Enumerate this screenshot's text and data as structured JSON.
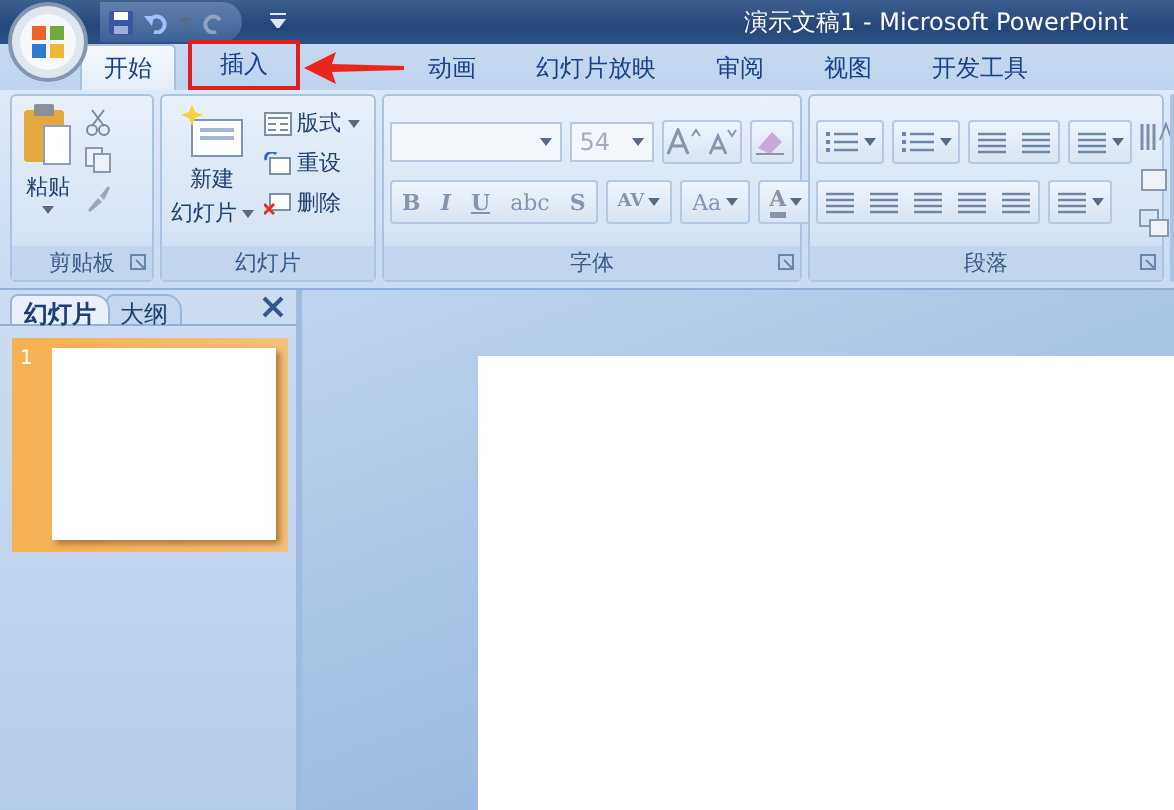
{
  "window": {
    "title": "演示文稿1 - Microsoft PowerPoint"
  },
  "tabs": [
    {
      "label": "开始",
      "selected": true,
      "highlighted": false
    },
    {
      "label": "插入",
      "selected": false,
      "highlighted": true
    },
    {
      "label": "动画",
      "selected": false,
      "highlighted": false
    },
    {
      "label": "幻灯片放映",
      "selected": false,
      "highlighted": false
    },
    {
      "label": "审阅",
      "selected": false,
      "highlighted": false
    },
    {
      "label": "视图",
      "selected": false,
      "highlighted": false
    },
    {
      "label": "开发工具",
      "selected": false,
      "highlighted": false
    }
  ],
  "ribbon": {
    "clipboard": {
      "label": "剪贴板",
      "paste": "粘贴"
    },
    "slides": {
      "label": "幻灯片",
      "new_slide": [
        "新建",
        "幻灯片"
      ],
      "items": [
        "版式",
        "重设",
        "删除"
      ]
    },
    "font": {
      "label": "字体",
      "size": "54",
      "format_buttons": [
        "B",
        "I",
        "U",
        "abc",
        "S",
        "AV",
        "Aa",
        "A"
      ]
    },
    "paragraph": {
      "label": "段落"
    }
  },
  "side_panel": {
    "tabs": [
      {
        "label": "幻灯片",
        "selected": true
      },
      {
        "label": "大纲",
        "selected": false
      }
    ],
    "thumbnails": [
      {
        "number": "1",
        "selected": true
      }
    ]
  }
}
